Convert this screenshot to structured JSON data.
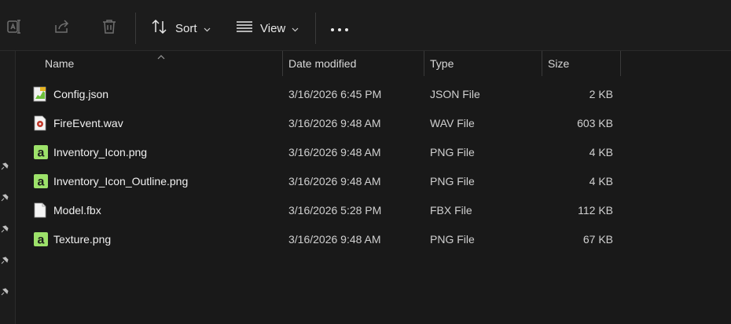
{
  "toolbar": {
    "sort_label": "Sort",
    "view_label": "View",
    "icons": [
      "rename-icon",
      "share-icon",
      "delete-icon",
      "sort-icon",
      "view-icon",
      "more-icon"
    ]
  },
  "columns": {
    "name": "Name",
    "date": "Date modified",
    "type": "Type",
    "size": "Size"
  },
  "files": [
    {
      "name": "Config.json",
      "date": "3/16/2026 6:45 PM",
      "type": "JSON File",
      "size": "2 KB",
      "icon": "json-file-icon"
    },
    {
      "name": "FireEvent.wav",
      "date": "3/16/2026 9:48 AM",
      "type": "WAV File",
      "size": "603 KB",
      "icon": "audio-file-icon"
    },
    {
      "name": "Inventory_Icon.png",
      "date": "3/16/2026 9:48 AM",
      "type": "PNG File",
      "size": "4 KB",
      "icon": "image-file-icon"
    },
    {
      "name": "Inventory_Icon_Outline.png",
      "date": "3/16/2026 9:48 AM",
      "type": "PNG File",
      "size": "4 KB",
      "icon": "image-file-icon"
    },
    {
      "name": "Model.fbx",
      "date": "3/16/2026 5:28 PM",
      "type": "FBX File",
      "size": "112 KB",
      "icon": "blank-file-icon"
    },
    {
      "name": "Texture.png",
      "date": "3/16/2026 9:48 AM",
      "type": "PNG File",
      "size": "67 KB",
      "icon": "image-file-icon"
    }
  ],
  "colors": {
    "background": "#191919",
    "toolbar": "#1c1c1c",
    "png_icon": "#9de26a",
    "text": "#e6e6e6"
  }
}
